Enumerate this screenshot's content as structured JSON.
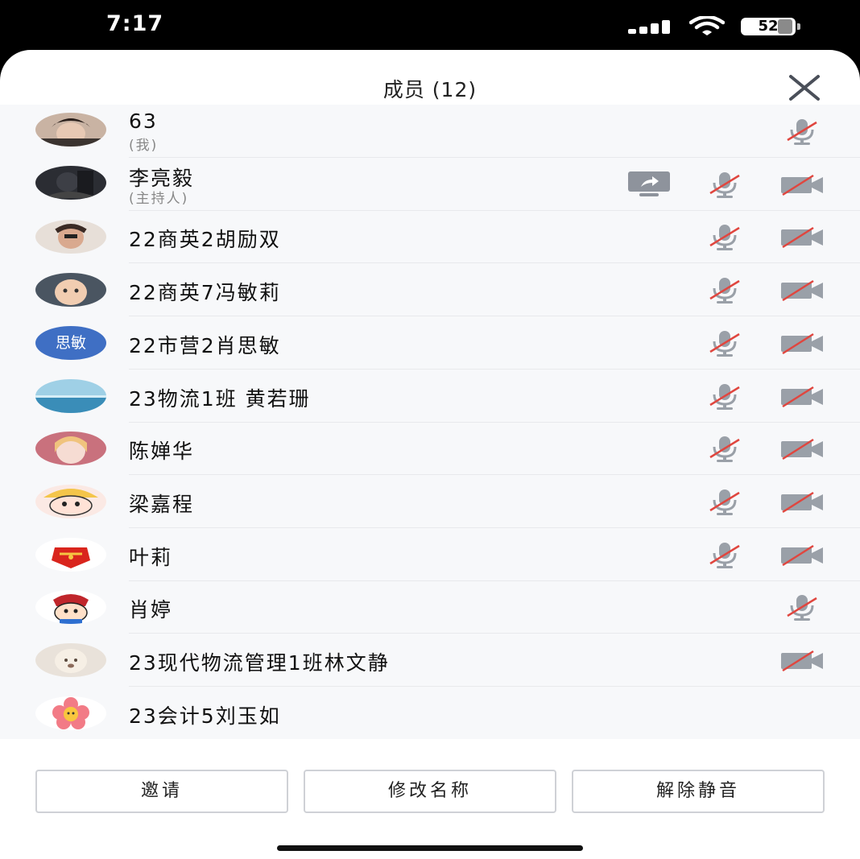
{
  "status_bar": {
    "time": "7:17",
    "battery": "52",
    "battery_level": 0.52
  },
  "sheet": {
    "title": "成员 (12)"
  },
  "members": [
    {
      "name": "63",
      "subtitle": "(我)",
      "avatar": "photo-boy",
      "share_screen": false,
      "mic_muted": true,
      "mic_position": "right",
      "camera_off": false
    },
    {
      "name": "李亮毅",
      "subtitle": "(主持人)",
      "avatar": "photo-dark",
      "share_screen": true,
      "mic_muted": true,
      "mic_position": "mid",
      "camera_off": true
    },
    {
      "name": "22商英2胡励双",
      "subtitle": "",
      "avatar": "photo-girl",
      "share_screen": false,
      "mic_muted": true,
      "mic_position": "mid",
      "camera_off": true
    },
    {
      "name": "22商英7冯敏莉",
      "subtitle": "",
      "avatar": "photo-baby",
      "share_screen": false,
      "mic_muted": true,
      "mic_position": "mid",
      "camera_off": true
    },
    {
      "name": "22市营2肖思敏",
      "subtitle": "",
      "avatar": "text",
      "avatar_text": "思敏",
      "avatar_color": "#3f6fc4",
      "share_screen": false,
      "mic_muted": true,
      "mic_position": "mid",
      "camera_off": true
    },
    {
      "name": "23物流1班 黄若珊",
      "subtitle": "",
      "avatar": "photo-sea",
      "share_screen": false,
      "mic_muted": true,
      "mic_position": "mid",
      "camera_off": true
    },
    {
      "name": "陈婵华",
      "subtitle": "",
      "avatar": "photo-anime",
      "share_screen": false,
      "mic_muted": true,
      "mic_position": "mid",
      "camera_off": true
    },
    {
      "name": "梁嘉程",
      "subtitle": "",
      "avatar": "cartoon-boy",
      "share_screen": false,
      "mic_muted": true,
      "mic_position": "mid",
      "camera_off": true
    },
    {
      "name": "叶莉",
      "subtitle": "",
      "avatar": "badge-red",
      "share_screen": false,
      "mic_muted": true,
      "mic_position": "mid",
      "camera_off": true
    },
    {
      "name": "肖婷",
      "subtitle": "",
      "avatar": "cartoon-shin",
      "share_screen": false,
      "mic_muted": true,
      "mic_position": "right",
      "camera_off": false
    },
    {
      "name": "23现代物流管理1班林文静",
      "subtitle": "",
      "avatar": "photo-dog",
      "share_screen": false,
      "mic_muted": false,
      "mic_position": "none",
      "camera_off": true
    },
    {
      "name": "23会计5刘玉如",
      "subtitle": "",
      "avatar": "flower",
      "share_screen": false,
      "mic_muted": false,
      "mic_position": "none",
      "camera_off": false
    }
  ],
  "buttons": {
    "invite": "邀请",
    "rename": "修改名称",
    "unmute": "解除静音"
  },
  "colors": {
    "muted_slash": "#e0463f",
    "icon_gray": "#8e939c",
    "avatar_blue": "#3f6fc4"
  }
}
